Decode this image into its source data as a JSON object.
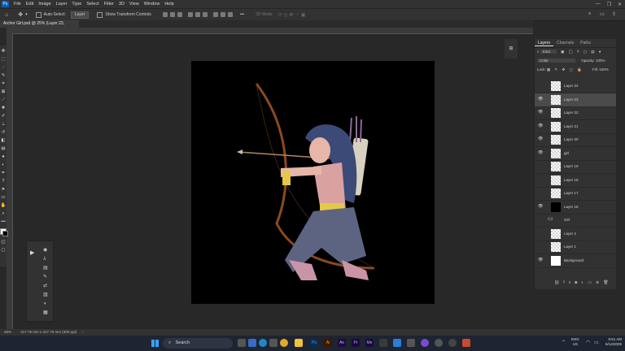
{
  "menu": {
    "logo": "Ps",
    "items": [
      "File",
      "Edit",
      "Image",
      "Layer",
      "Type",
      "Select",
      "Filter",
      "3D",
      "View",
      "Window",
      "Help"
    ]
  },
  "options": {
    "auto_select_label": "Auto-Select:",
    "auto_select_value": "Layer",
    "transform_label": "Show Transform Controls",
    "mode_3d_label": "3D Mode:"
  },
  "document": {
    "tab_title": "Archer Girl.psd @ 25% (Layer 23, RGB/8#) *"
  },
  "layers_panel": {
    "tabs": [
      "Layers",
      "Channels",
      "Paths"
    ],
    "kind_label": "Kind",
    "blend_mode": "Color",
    "opacity_label": "Opacity:",
    "opacity_value": "100%",
    "lock_label": "Lock:",
    "fill_label": "Fill:",
    "fill_value": "100%",
    "layers": [
      {
        "name": "Layer 24",
        "visible": false,
        "selected": false
      },
      {
        "name": "Layer 23",
        "visible": true,
        "selected": true
      },
      {
        "name": "Layer 22",
        "visible": true,
        "selected": false
      },
      {
        "name": "Layer 21",
        "visible": true,
        "selected": false
      },
      {
        "name": "Layer 20",
        "visible": true,
        "selected": false
      },
      {
        "name": "girl",
        "visible": true,
        "selected": false
      },
      {
        "name": "Layer 19",
        "visible": false,
        "selected": false
      },
      {
        "name": "Layer 18",
        "visible": false,
        "selected": false
      },
      {
        "name": "Layer 17",
        "visible": false,
        "selected": false
      },
      {
        "name": "Layer 16",
        "visible": true,
        "selected": false
      },
      {
        "name": "Girl",
        "visible": false,
        "selected": false
      },
      {
        "name": "Layer 2",
        "visible": false,
        "selected": false
      },
      {
        "name": "Layer 1",
        "visible": false,
        "selected": false
      },
      {
        "name": "Background",
        "visible": true,
        "selected": false
      }
    ]
  },
  "status": {
    "zoom": "25%",
    "size": "317.75 mm x 317.75 mm (300 ppi)"
  },
  "taskbar": {
    "search_placeholder": "Search",
    "lang": "ENG",
    "region": "US",
    "time": "8:51 AM",
    "date": "6/14/2025"
  },
  "colors": {
    "ps_blue": "#0b5fb8",
    "panel_bg": "#323232",
    "workspace_bg": "#282828",
    "canvas_bg": "#000000"
  }
}
